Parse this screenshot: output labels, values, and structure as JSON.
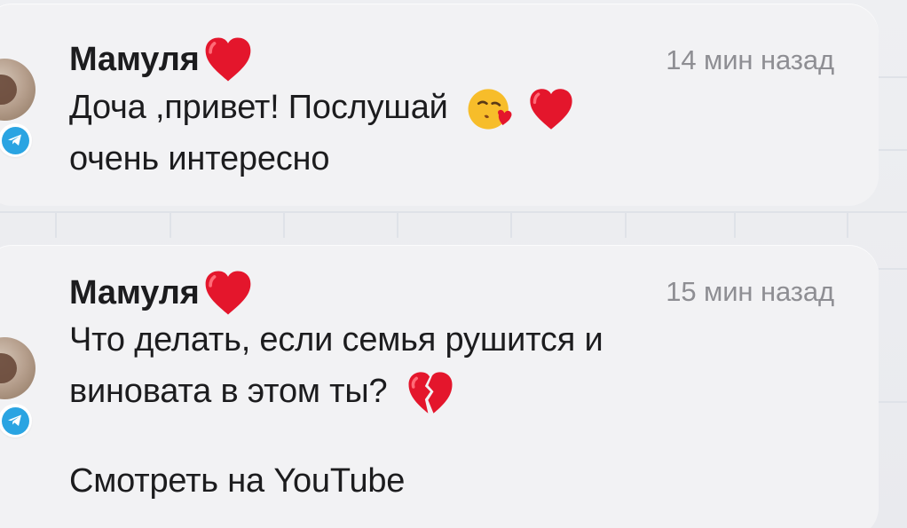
{
  "notifications": [
    {
      "sender": "Мамуля",
      "time": "14 мин назад",
      "message_lines": [
        "Доча ,привет! Послушай",
        "очень интересно"
      ],
      "sender_icon": "red-heart-icon",
      "message_icons": [
        "kissing-face-icon",
        "red-heart-icon"
      ],
      "app_icon": "telegram-icon"
    },
    {
      "sender": "Мамуля",
      "time": "15 мин назад",
      "message_lines": [
        "Что делать, если семья рушится и",
        "виновата в этом ты?"
      ],
      "link_text": "Смотреть на YouTube",
      "sender_icon": "red-heart-icon",
      "message_icons": [
        "broken-heart-icon"
      ],
      "app_icon": "telegram-icon"
    }
  ],
  "colors": {
    "background": "#ecedf0",
    "card": "#f2f2f4",
    "text": "#1c1c1e",
    "timestamp": "#8e8e93",
    "telegram": "#2aa4e2",
    "heart": "#e4162c"
  }
}
